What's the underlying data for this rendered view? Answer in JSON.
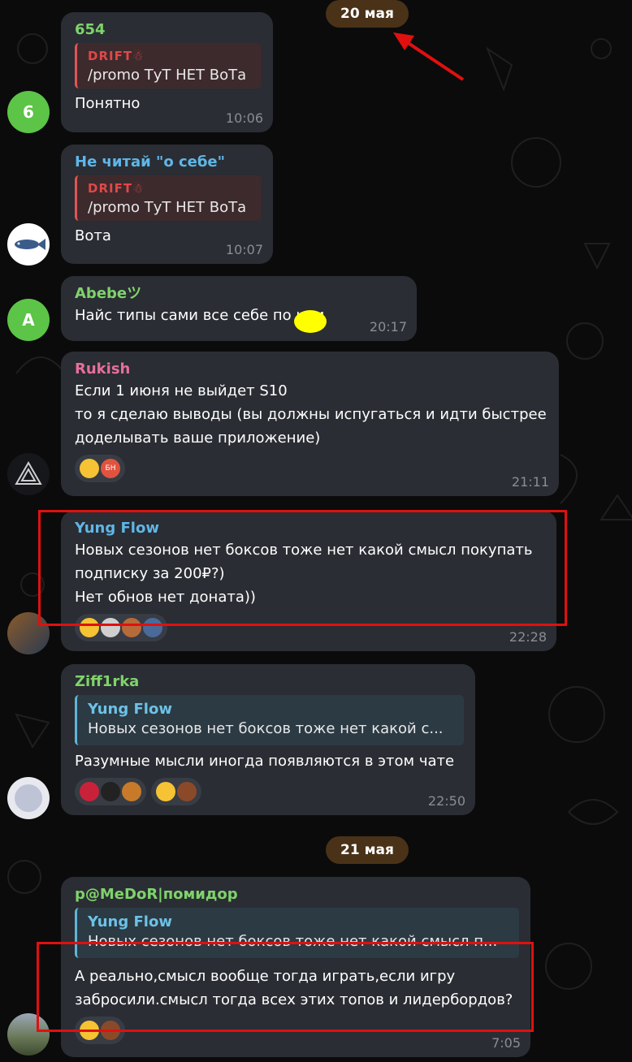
{
  "dates": {
    "first": "20 мая",
    "second": "21 мая"
  },
  "messages": [
    {
      "sender": "654",
      "sender_color": "#7fd36b",
      "reply_name": "DRIFT☃",
      "reply_text": "/promo ТуТ НЕТ ВоТа",
      "lines": [
        "Понятно"
      ],
      "time": "10:06",
      "avatar_letter": "6"
    },
    {
      "sender": "Не читай \"о себе\"",
      "sender_color": "#5fb6e8",
      "reply_name": "DRIFT☃",
      "reply_text": "/promo ТуТ НЕТ ВоТа",
      "lines": [
        "Вота"
      ],
      "time": "10:07"
    },
    {
      "sender": "Abebeツ",
      "sender_color": "#7fd36b",
      "lines": [
        "Найс типы сами все себе по     или"
      ],
      "time": "20:17",
      "avatar_letter": "A"
    },
    {
      "sender": "Rukish",
      "sender_color": "#e56f9a",
      "lines": [
        "Если 1 июня не выйдет S10",
        "то я сделаю выводы (вы должны испугаться и идти быстрее",
        "доделывать ваше приложение)"
      ],
      "time": "21:11",
      "reaction_badge": "БН"
    },
    {
      "sender": "Yung Flow",
      "sender_color": "#5fb6e8",
      "lines": [
        "Новых сезонов нет боксов тоже нет какой смысл покупать",
        "подписку за 200₽?)",
        "Нет обнов нет доната))"
      ],
      "time": "22:28"
    },
    {
      "sender": "Ziff1rka",
      "sender_color": "#7fd36b",
      "reply_name": "Yung Flow",
      "reply_text": "Новых сезонов нет боксов тоже нет какой с...",
      "lines": [
        "Разумные мысли иногда появляются в этом чате"
      ],
      "time": "22:50"
    },
    {
      "sender": "p@MeDoR|помидор",
      "sender_color": "#7fd36b",
      "reply_name": "Yung Flow",
      "reply_text": "Новых сезонов нет боксов тоже нет какой смысл п...",
      "lines": [
        "А реально,смысл вообще тогда играть,если игру",
        "забросили.смысл тогда всех этих топов и лидербордов?"
      ],
      "time": "7:05"
    }
  ],
  "colors": {
    "bubble": "#2a2d33",
    "date_pill": "#4a3218",
    "highlight": "#e01010",
    "time": "#8a8d93"
  }
}
